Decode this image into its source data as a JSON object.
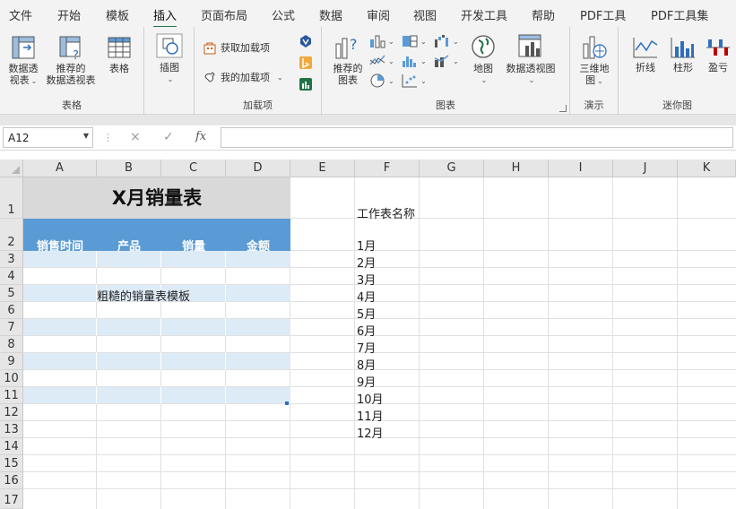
{
  "menu": {
    "tabs": [
      "文件",
      "开始",
      "模板",
      "插入",
      "页面布局",
      "公式",
      "数据",
      "审阅",
      "视图",
      "开发工具",
      "帮助",
      "PDF工具",
      "PDF工具集"
    ],
    "active": "插入"
  },
  "ribbon": {
    "tables": {
      "label": "表格",
      "pivot_line1": "数据透",
      "pivot_line2": "视表",
      "rec_pivot_line1": "推荐的",
      "rec_pivot_line2": "数据透视表",
      "table": "表格"
    },
    "illustrations": {
      "insert_picture": "插图"
    },
    "addins": {
      "label": "加载项",
      "get_addins": "获取加载项",
      "my_addins": "我的加载项"
    },
    "charts": {
      "label": "图表",
      "rec_charts_line1": "推荐的",
      "rec_charts_line2": "图表",
      "map": "地图",
      "pivot_chart": "数据透视图"
    },
    "tours": {
      "label": "演示",
      "map3d_line1": "三维地",
      "map3d_line2": "图"
    },
    "sparklines": {
      "label": "迷你图",
      "line": "折线",
      "column": "柱形",
      "win_loss": "盈亏"
    }
  },
  "formula_bar": {
    "name_box": "A12",
    "cancel_icon": "×",
    "enter_icon": "✓",
    "fx_label": "fx",
    "formula": ""
  },
  "columns": [
    "A",
    "B",
    "C",
    "D",
    "E",
    "F",
    "G",
    "H",
    "I",
    "J",
    "K"
  ],
  "rows": [
    "1",
    "2",
    "3",
    "4",
    "5",
    "6",
    "7",
    "8",
    "9",
    "10",
    "11",
    "12",
    "13",
    "14",
    "15",
    "16",
    "17"
  ],
  "sheet": {
    "title": "X月销量表",
    "headers": [
      "销售时间",
      "产品",
      "销量",
      "金额"
    ],
    "note": "粗糙的销量表模板",
    "sheet_names_label": "工作表名称",
    "months": [
      "1月",
      "2月",
      "3月",
      "4月",
      "5月",
      "6月",
      "7月",
      "8月",
      "9月",
      "10月",
      "11月",
      "12月"
    ]
  },
  "colors": {
    "title_fill": "#d9d9d9",
    "header_fill": "#5b9bd5",
    "stripe_fill": "#ddebf7",
    "accent": "#217346"
  }
}
